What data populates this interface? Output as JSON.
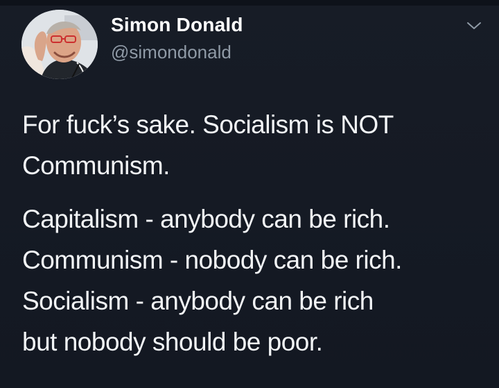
{
  "author": {
    "display_name": "Simon Donald",
    "handle": "@simondonald",
    "avatar_icon": "profile-photo"
  },
  "menu": {
    "icon": "chevron-down-icon"
  },
  "tweet": {
    "paragraph_1": {
      "line_1": "For fuck’s sake. Socialism is NOT",
      "line_2": "Communism."
    },
    "paragraph_2": {
      "line_1": "Capitalism - anybody can be rich.",
      "line_2": "Communism - nobody can be rich.",
      "line_3": "Socialism - anybody can be rich",
      "line_4": "but nobody should be poor."
    }
  },
  "colors": {
    "background": "#151a24",
    "text": "#f4f6f8",
    "handle": "#8f9aa6"
  }
}
